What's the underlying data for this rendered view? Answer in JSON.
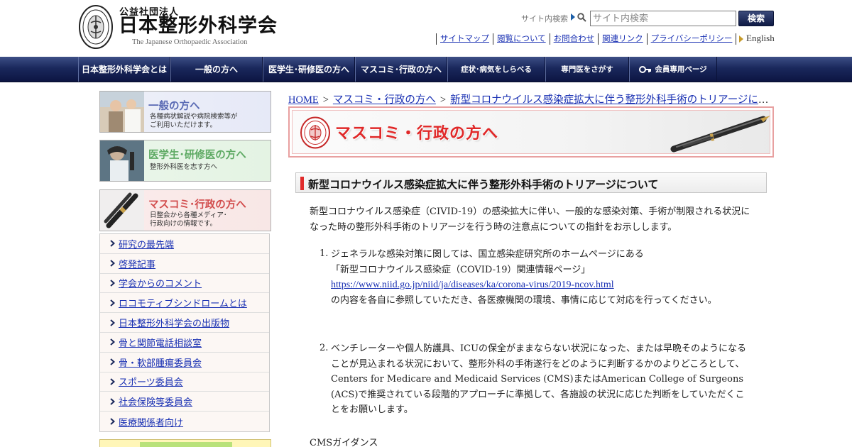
{
  "header": {
    "org_type": "公益社団法人",
    "org_name": "日本整形外科学会",
    "org_name_en": "The Japanese Orthopaedic Association",
    "search_label": "サイト内検索",
    "search_placeholder": "サイト内検索",
    "search_button": "検索",
    "links": [
      "サイトマップ",
      "閲覧について",
      "お問合わせ",
      "関連リンク",
      "プライバシーポリシー"
    ],
    "english": "English"
  },
  "nav": {
    "items": [
      "日本整形外科学会とは",
      "一般の方へ",
      "医学生･研修医の方へ",
      "マスコミ･行政の方へ",
      "症状･病気をしらべる",
      "専門医をさがす",
      "会員専用ページ"
    ]
  },
  "sidebar": {
    "banners": [
      {
        "title": "一般の方へ",
        "desc1": "各種病状解説や病院検索等が",
        "desc2": "ご利用いただけます。"
      },
      {
        "title": "医学生･研修医の方へ",
        "desc1": "整形外科医を志す方へ",
        "desc2": ""
      },
      {
        "title": "マスコミ･行政の方へ",
        "desc1": "日整会から各種メディア･",
        "desc2": "行政向けの情報です。"
      }
    ],
    "menu": [
      "研究の最先端",
      "啓発記事",
      "学会からのコメント",
      "ロコモティブシンドロームとは",
      "日本整形外科学会の出版物",
      "骨と関節電話相談室",
      "骨・軟部腫瘍委員会",
      "スポーツ委員会",
      "社会保険等委員会",
      "医療関係者向け"
    ]
  },
  "breadcrumb": {
    "home": "HOME",
    "section": "マスコミ・行政の方へ",
    "current": "新型コロナウイルス感染症拡大に伴う整形外科手術のトリアージについて"
  },
  "page_banner": {
    "title": "マスコミ・行政の方へ"
  },
  "article": {
    "heading": "新型コロナウイルス感染症拡大に伴う整形外科手術のトリアージについて",
    "intro": "新型コロナウイルス感染症（CIVID-19）の感染拡大に伴い、一般的な感染対策、手術が制限される状況になった時の整形外科手術のトリアージを行う時の注意点についての指針をお示しします。",
    "item1_num": "1.",
    "item1_line1": "ジェネラルな感染対策に関しては、国立感染症研究所のホームページにある",
    "item1_line2": "「新型コロナウイルス感染症（COVID-19）関連情報ページ」",
    "item1_link": "https://www.niid.go.jp/niid/ja/diseases/ka/corona-virus/2019-ncov.html",
    "item1_line3": "の内容を各自に参照していただき、各医療機関の環境、事情に応じて対応を行ってください。",
    "item2_num": "2.",
    "item2_text": "ベンチレーターや個人防護具、ICUの保全がままならない状況になった、または早晩そのようになることが見込まれる状況において、整形外科の手術遂行をどのように判断するかのよりどころとして、Centers for Medicare and Medicaid Services (CMS)またはAmerican College of Surgeons (ACS)で推奨されている段階的アプローチに準拠して、各施設の状況に応じた判断をしていただくことをお願いします。",
    "cms_label": "CMSガイダンス"
  },
  "colors": {
    "nav_bg": "#1a285c",
    "link": "#1a31b3",
    "accent_red": "#e02828"
  }
}
